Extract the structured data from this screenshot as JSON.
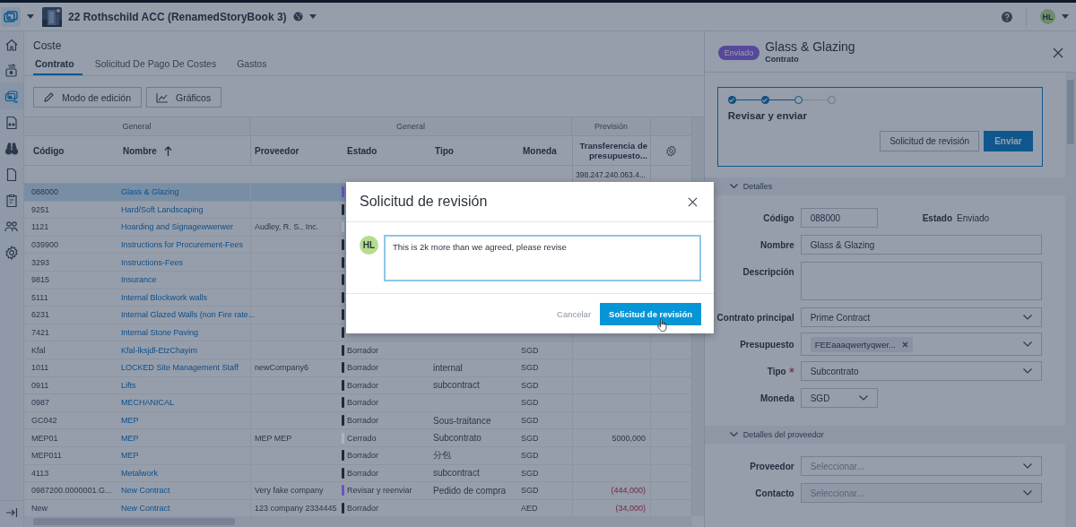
{
  "top_bar": {
    "project": "22 Rothschild ACC (RenamedStoryBook 3)",
    "user_initials": "HL"
  },
  "sidebar": {
    "items": [
      {
        "kind": "home",
        "selected": false
      },
      {
        "kind": "transfer",
        "selected": false
      },
      {
        "kind": "cost",
        "selected": true
      },
      {
        "kind": "compare",
        "selected": false
      },
      {
        "kind": "binoculars",
        "selected": false
      },
      {
        "kind": "file",
        "selected": false
      },
      {
        "kind": "report",
        "selected": false
      },
      {
        "kind": "people",
        "selected": false
      },
      {
        "kind": "settings",
        "selected": false
      }
    ]
  },
  "page": {
    "title": "Coste",
    "tabs": [
      {
        "label": "Contrato",
        "selected": true
      },
      {
        "label": "Solicitud De Pago De Costes",
        "selected": false
      },
      {
        "label": "Gastos",
        "selected": false
      }
    ],
    "toolbar": [
      {
        "kind": "edit",
        "label": "Modo de edición"
      },
      {
        "kind": "chart",
        "label": "Gráficos"
      }
    ]
  },
  "table": {
    "groups": [
      {
        "label": "General"
      },
      {
        "label": "General"
      },
      {
        "label": "Previsión"
      }
    ],
    "columns": [
      {
        "label": "Código"
      },
      {
        "label": "Nombre",
        "sort_ascending": true
      },
      {
        "label": "Proveedor"
      },
      {
        "label": "Estado"
      },
      {
        "label": "Tipo"
      },
      {
        "label": "Moneda"
      },
      {
        "label": "Transferencia de presupuesto..."
      }
    ],
    "filter_total": "398.247.240.063.4...",
    "rows": [
      {
        "code": "088000",
        "name": "Glass & Glazing",
        "color": "#6a52c4",
        "selected": true
      },
      {
        "code": "9251",
        "name": "Hard/Soft Landscaping",
        "color": "#1f2a38",
        "selected": false
      },
      {
        "code": "1121",
        "name": "Hoarding and Signagewwerwer",
        "supplier": "Audley, R. S., Inc.",
        "color": "#aab4c2",
        "selected": false
      },
      {
        "code": "039900",
        "name": "Instructions for Procurement-Fees",
        "color": "#1f2a38",
        "selected": false
      },
      {
        "code": "3293",
        "name": "Instructions-Fees",
        "color": "#1f2a38",
        "selected": false
      },
      {
        "code": "9815",
        "name": "Insurance",
        "color": "#1f2a38",
        "selected": false
      },
      {
        "code": "5111",
        "name": "Internal Blockwork walls",
        "color": "#1f2a38",
        "selected": false
      },
      {
        "code": "6231",
        "name": "Internal Glazed Walls (non Fire rate...",
        "color": "#1f2a38",
        "selected": false
      },
      {
        "code": "7421",
        "name": "Internal Stone Paving",
        "color": "#1f2a38",
        "selected": false
      },
      {
        "code": "Kfal",
        "name": "Kfal-lksjdl-EtzChayim",
        "status": "Borrador",
        "color": "#1f2a38",
        "currency": "SGD",
        "selected": false
      },
      {
        "code": "1011",
        "name": "LOCKED Site Management Staff",
        "supplier": "newCompany6",
        "status": "Borrador",
        "color": "#1f2a38",
        "type": "internal",
        "currency": "SGD",
        "selected": false
      },
      {
        "code": "0911",
        "name": "Lifts",
        "status": "Borrador",
        "color": "#1f2a38",
        "type": "subcontract",
        "currency": "SGD",
        "selected": false
      },
      {
        "code": "0987",
        "name": "MECHANICAL",
        "status": "Borrador",
        "color": "#1f2a38",
        "currency": "SGD",
        "selected": false
      },
      {
        "code": "GC042",
        "name": "MEP",
        "status": "Borrador",
        "color": "#1f2a38",
        "type": "Sous-traitance",
        "currency": "SGD",
        "selected": false
      },
      {
        "code": "MEP01",
        "name": "MEP",
        "supplier": "MEP MEP",
        "status": "Cerrado",
        "color": "#aab4c2",
        "type": "Subcontrato",
        "currency": "SGD",
        "forecast": "5000,000",
        "negative": false,
        "selected": false
      },
      {
        "code": "MEP011",
        "name": "MEP",
        "status": "Borrador",
        "color": "#1f2a38",
        "type": "分包",
        "currency": "SGD",
        "selected": false
      },
      {
        "code": "4113",
        "name": "Metalwork",
        "status": "Borrador",
        "color": "#1f2a38",
        "type": "subcontract",
        "currency": "SGD",
        "selected": false
      },
      {
        "code": "0987200.0000001.G...",
        "name": "New Contract",
        "supplier": "Very fake company",
        "status": "Revisar y reenviar",
        "color": "#6a52c4",
        "type": "Pedido de compra",
        "currency": "SGD",
        "forecast": "(444,000)",
        "negative": true,
        "selected": false
      },
      {
        "code": "New",
        "name": "New Contract",
        "supplier": "123 company 2334445",
        "status": "Borrador",
        "color": "#1f2a38",
        "currency": "AED",
        "forecast": "(34,000)",
        "negative": true,
        "selected": false
      }
    ]
  },
  "panel": {
    "badge": "Enviado",
    "title": "Glass & Glazing",
    "subtitle": "Contrato",
    "workflow": {
      "steps": [
        {
          "done": true,
          "current": false
        },
        {
          "done": true,
          "current": false
        },
        {
          "done": false,
          "current": true
        },
        {
          "done": false,
          "current": false
        }
      ],
      "step_label": "Revisar y enviar",
      "buttons": [
        {
          "kind": "secondary",
          "label": "Solicitud de revisión"
        },
        {
          "kind": "primary",
          "label": "Enviar"
        }
      ]
    },
    "sections": [
      {
        "title": "Detalles",
        "expanded": true,
        "fields": [
          {
            "kind": "input",
            "label": "Código",
            "value": "088000",
            "side_label": "Estado",
            "side_value": "Enviado"
          },
          {
            "kind": "input",
            "label": "Nombre",
            "value": "Glass & Glazing"
          },
          {
            "kind": "textarea",
            "label": "Descripción"
          },
          {
            "kind": "select",
            "label": "Contrato principal",
            "value": "Prime Contract"
          },
          {
            "kind": "tags",
            "label": "Presupuesto",
            "tags": [
              "FEEaaaqwertyqwer..."
            ]
          },
          {
            "kind": "select",
            "label": "Tipo",
            "value": "Subcontrato",
            "required": true
          },
          {
            "kind": "select",
            "label": "Moneda",
            "value": "SGD",
            "compact": true
          }
        ]
      },
      {
        "title": "Detalles del proveedor",
        "expanded": true,
        "fields": [
          {
            "kind": "select",
            "label": "Proveedor",
            "placeholder": "Seleccionar..."
          },
          {
            "kind": "select",
            "label": "Contacto",
            "placeholder": "Seleccionar...",
            "disabled": true
          }
        ]
      }
    ]
  },
  "modal": {
    "title": "Solicitud de revisión",
    "avatar_initials": "HL",
    "comment": "This is 2k more than we agreed, please revise",
    "buttons": [
      {
        "kind": "secondary",
        "label": "Cancelar"
      },
      {
        "kind": "primary",
        "label": "Solicitud de revisión"
      }
    ]
  }
}
